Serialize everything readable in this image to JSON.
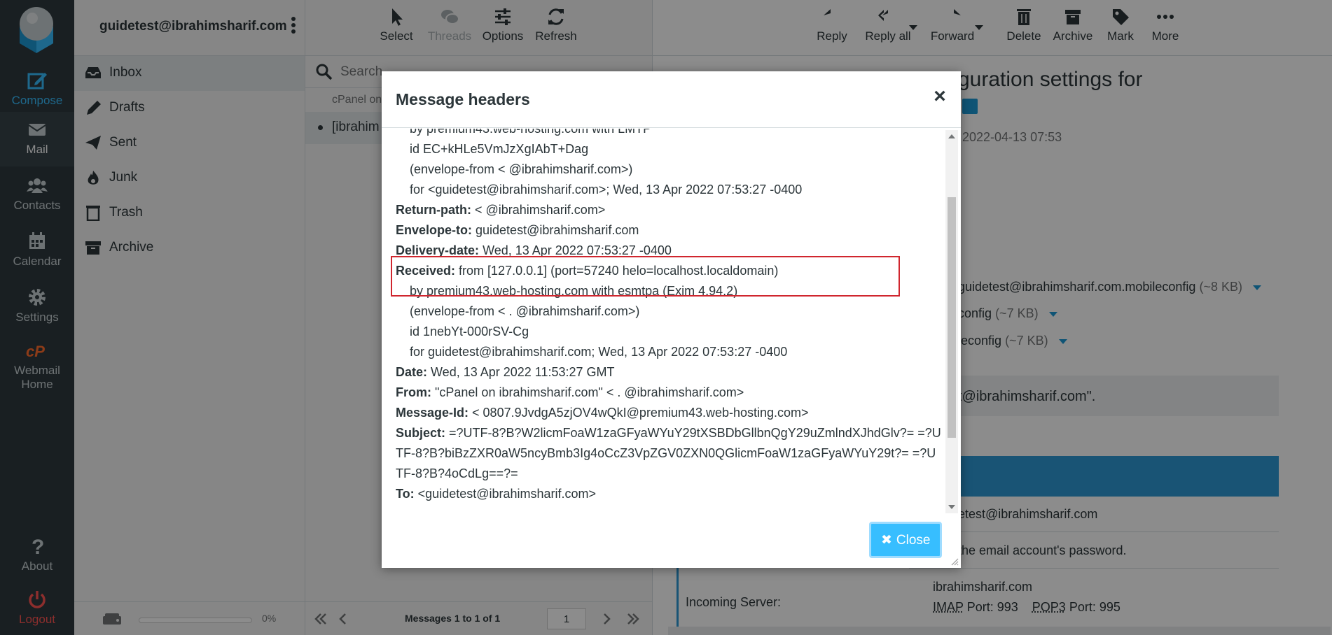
{
  "rail": {
    "compose": "Compose",
    "mail": "Mail",
    "contacts": "Contacts",
    "calendar": "Calendar",
    "settings": "Settings",
    "webmail_home_1": "Webmail",
    "webmail_home_2": "Home",
    "about": "About",
    "logout": "Logout"
  },
  "account": {
    "email": "guidetest@ibrahimsharif.com"
  },
  "folders": [
    {
      "label": "Inbox"
    },
    {
      "label": "Drafts"
    },
    {
      "label": "Sent"
    },
    {
      "label": "Junk"
    },
    {
      "label": "Trash"
    },
    {
      "label": "Archive"
    }
  ],
  "quota": {
    "percent_label": "0%",
    "used_fraction": 0.0
  },
  "list_toolbar": {
    "select": "Select",
    "threads": "Threads",
    "options": "Options",
    "refresh": "Refresh"
  },
  "search": {
    "placeholder": "Search"
  },
  "message_list": {
    "row1_from": "cPanel on",
    "row2_from": "[ibrahim"
  },
  "pager": {
    "info": "Messages 1 to 1 of 1",
    "page": "1"
  },
  "pane_toolbar": {
    "reply": "Reply",
    "reply_all": "Reply all",
    "forward": "Forward",
    "delete": "Delete",
    "archive": "Archive",
    "mark": "Mark",
    "more": "More"
  },
  "pane": {
    "subject_visible": "guration settings for",
    "date_visible": "2022-04-13 07:53",
    "attachments": [
      {
        "name": "guidetest@ibrahimsharif.com.mobileconfig",
        "size": "(~8 KB)"
      },
      {
        "name": "config",
        "size": "(~7 KB)"
      },
      {
        "name": "leconfig",
        "size": "(~7 KB)"
      }
    ],
    "gray_text": "t@ibrahimsharif.com\".",
    "row_email": "etest@ibrahimsharif.com",
    "row_password": "the email account's password.",
    "incoming_label": "Incoming Server:",
    "incoming_host": "ibrahimsharif.com",
    "imap_label": "IMAP",
    "imap_port": "Port: 993",
    "pop3_label": "POP3",
    "pop3_port": "Port: 995"
  },
  "dialog": {
    "title": "Message headers",
    "close_label": "Close",
    "lines": {
      "l0": "by premium43.web-hosting.com with LMTP",
      "l1": "id EC+kHLe5VmJzXgIAbT+Dag",
      "l2": "(envelope-from <           @ibrahimsharif.com>)",
      "l3": "for <guidetest@ibrahimsharif.com>; Wed, 13 Apr 2022 07:53:27 -0400",
      "return_path_k": "Return-path:",
      "return_path_v": " <           @ibrahimsharif.com>",
      "envelope_to_k": "Envelope-to:",
      "envelope_to_v": " guidetest@ibrahimsharif.com",
      "delivery_date_k": "Delivery-date:",
      "delivery_date_v": " Wed, 13 Apr 2022 07:53:27 -0400",
      "received_k": "Received:",
      "received_v": " from [127.0.0.1] (port=57240 helo=localhost.localdomain)",
      "l4": "by premium43.web-hosting.com with esmtpa (Exim 4.94.2)",
      "l5": "(envelope-from <    .        @ibrahimsharif.com>)",
      "l6": "id 1nebYt-000rSV-Cg",
      "l7": "for guidetest@ibrahimsharif.com; Wed, 13 Apr 2022 07:53:27 -0400",
      "date_k": "Date:",
      "date_v": " Wed, 13 Apr 2022 11:53:27 GMT",
      "from_k": "From:",
      "from_v": " \"cPanel on ibrahimsharif.com\" <    .        @ibrahimsharif.com>",
      "message_id_k": "Message-Id:",
      "message_id_v": " <               0807.9JvdgA5zjOV4wQkI@premium43.web-hosting.com>",
      "subject_k": "Subject:",
      "subject_v": " =?UTF-8?B?W2licmFoaW1zaGFyaWYuY29tXSBDbGllbnQgY29uZmlndXJhdGlv?= =?UTF-8?B?biBzZXR0aW5ncyBmb3Ig4oCcZ3VpZGV0ZXN0QGlicmFoaW1zaGFyaWYuY29t?= =?UTF-8?B?4oCdLg==?=",
      "to_k": "To:",
      "to_v": " <guidetest@ibrahimsharif.com>"
    }
  },
  "colors": {
    "rail_bg": "#2f3a3f",
    "accent": "#37beff",
    "logout": "#ff5552",
    "highlight": "#d0262e"
  }
}
